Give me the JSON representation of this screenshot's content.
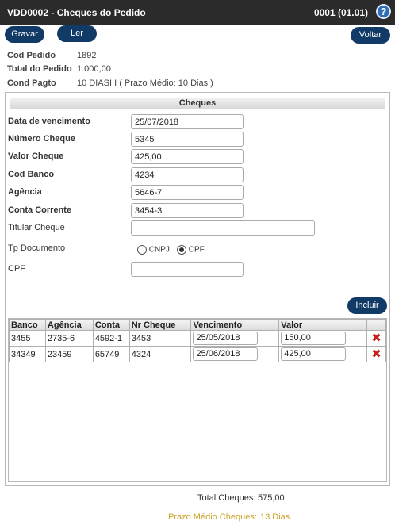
{
  "header": {
    "title": "VDD0002 - Cheques do Pedido",
    "code": "0001 (01.01)",
    "help_icon": "question-icon"
  },
  "toolbar": {
    "gravar_label": "Gravar",
    "ler_label": "Ler",
    "voltar_label": "Voltar"
  },
  "summary": {
    "cod_pedido_label": "Cod Pedido",
    "cod_pedido_value": "1892",
    "total_pedido_label": "Total do Pedido",
    "total_pedido_value": "1.000,00",
    "cond_pagto_label": "Cond Pagto",
    "cond_pagto_value": "10 DIASIII ( Prazo Médio: 10 Dias )"
  },
  "form": {
    "section_title": "Cheques",
    "vencimento_label": "Data de vencimento",
    "vencimento_value": "25/07/2018",
    "numero_label": "Número Cheque",
    "numero_value": "5345",
    "valor_label": "Valor Cheque",
    "valor_value": "425,00",
    "banco_label": "Cod Banco",
    "banco_value": "4234",
    "agencia_label": "Agência",
    "agencia_value": "5646-7",
    "conta_label": "Conta Corrente",
    "conta_value": "3454-3",
    "titular_label": "Titular Cheque",
    "titular_value": "",
    "tp_doc_label": "Tp Documento",
    "tp_doc_options": [
      "CNPJ",
      "CPF"
    ],
    "tp_doc_selected": "CPF",
    "cpf_label": "CPF",
    "cpf_value": "",
    "incluir_label": "Incluir"
  },
  "grid": {
    "columns": [
      "Banco",
      "Agência",
      "Conta",
      "Nr Cheque",
      "Vencimento",
      "Valor",
      ""
    ],
    "rows": [
      {
        "banco": "3455",
        "agencia": "2735-6",
        "conta": "4592-1",
        "nr_cheque": "3453",
        "vencimento": "25/05/2018",
        "valor": "150,00"
      },
      {
        "banco": "34349",
        "agencia": "23459",
        "conta": "65749",
        "nr_cheque": "4324",
        "vencimento": "25/06/2018",
        "valor": "425,00"
      }
    ],
    "delete_icon": "delete-x-icon"
  },
  "totals": {
    "total_label": "Total Cheques:",
    "total_value": "575,00",
    "prazo_label": "Prazo Médio Cheques:",
    "prazo_value": "13 Dias"
  },
  "colors": {
    "titlebar": "#2b2b2b",
    "button": "#123a66",
    "delete": "#c8201a",
    "prazo_text": "#c9a227"
  }
}
